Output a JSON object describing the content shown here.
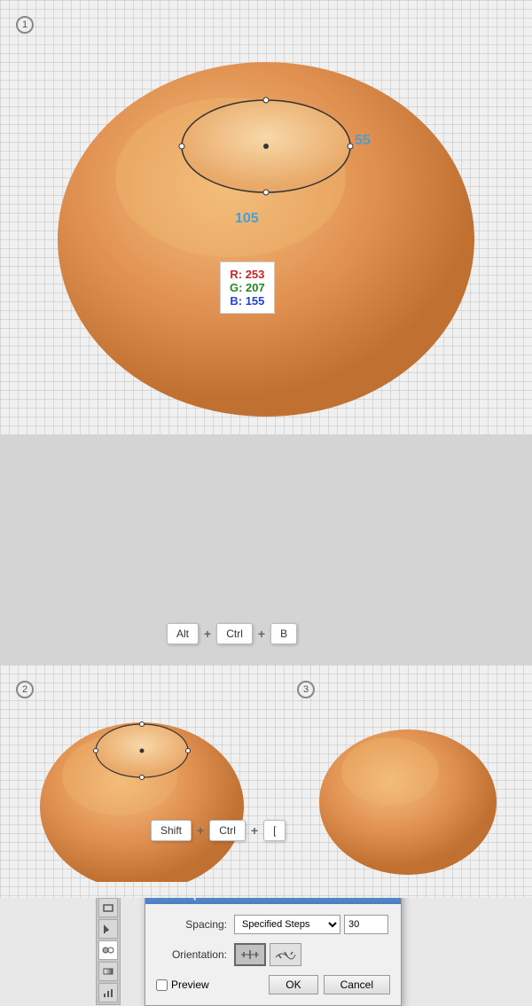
{
  "sections": {
    "section1": {
      "step_badge": "1",
      "egg_color_outer": "#e8a060",
      "egg_color_inner": "#f0b878",
      "rgb_label": {
        "r": "R: 253",
        "g": "G: 207",
        "b": "B: 155"
      },
      "dim_horizontal": "105",
      "dim_vertical": "55"
    },
    "section2": {
      "dialog": {
        "title": "Blend Options",
        "spacing_label": "Spacing:",
        "spacing_value": "Specified Steps",
        "spacing_input": "30",
        "orientation_label": "Orientation:",
        "preview_label": "Preview",
        "ok_label": "OK",
        "cancel_label": "Cancel"
      },
      "key_combo": {
        "key1": "Alt",
        "key2": "Ctrl",
        "key3": "B"
      }
    },
    "section3": {
      "step_badge2": "2",
      "step_badge3": "3",
      "key_combo2": {
        "key1": "Shift",
        "key2": "Ctrl",
        "key3": "["
      }
    }
  },
  "colors": {
    "accent_blue": "#4a9fd4",
    "rgb_r": "#cc2222",
    "rgb_g": "#228822",
    "rgb_b": "#2244cc",
    "egg_gradient_start": "#d4884a",
    "egg_gradient_end": "#f0b070"
  }
}
